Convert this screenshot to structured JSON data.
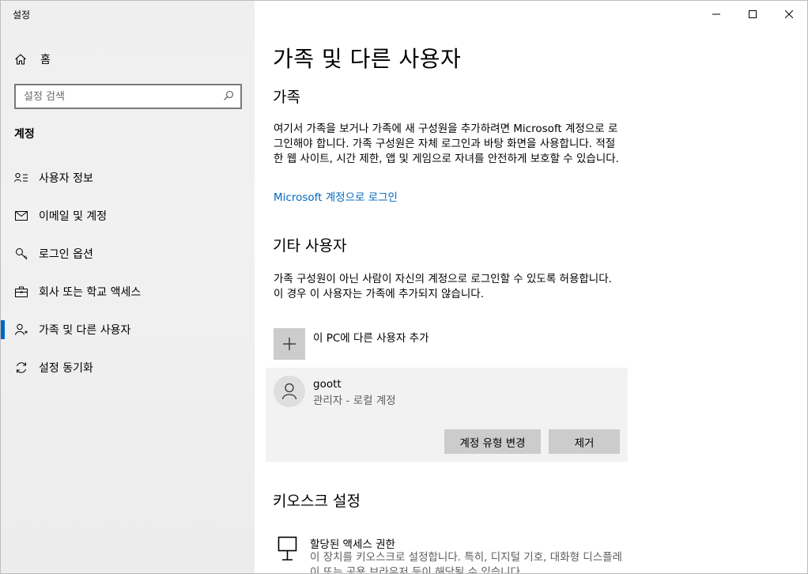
{
  "app": {
    "title": "설정"
  },
  "sidebar": {
    "home_label": "홈",
    "search_placeholder": "설정 검색",
    "section_label": "계정",
    "items": [
      {
        "label": "사용자 정보",
        "icon": "user-info-icon"
      },
      {
        "label": "이메일 및 계정",
        "icon": "mail-icon"
      },
      {
        "label": "로그인 옵션",
        "icon": "key-icon"
      },
      {
        "label": "회사 또는 학교 액세스",
        "icon": "briefcase-icon"
      },
      {
        "label": "가족 및 다른 사용자",
        "icon": "person-add-icon",
        "selected": true
      },
      {
        "label": "설정 동기화",
        "icon": "sync-icon"
      }
    ]
  },
  "main": {
    "title": "가족 및 다른 사용자",
    "family": {
      "heading": "가족",
      "description": "여기서 가족을 보거나 가족에 새 구성원을 추가하려면 Microsoft 계정으로 로그인해야 합니다. 가족 구성원은 자체 로그인과 바탕 화면을 사용합니다. 적절한 웹 사이트, 시간 제한, 앱 및 게임으로 자녀를 안전하게 보호할 수 있습니다.",
      "link": "Microsoft 계정으로 로그인"
    },
    "other_users": {
      "heading": "기타 사용자",
      "description": "가족 구성원이 아닌 사람이 자신의 계정으로 로그인할 수 있도록 허용합니다. 이 경우 이 사용자는 가족에 추가되지 않습니다.",
      "add_label": "이 PC에 다른 사용자 추가",
      "user": {
        "name": "goott",
        "role": "관리자 - 로컬 계정",
        "change_type_label": "계정 유형 변경",
        "remove_label": "제거"
      }
    },
    "kiosk": {
      "heading": "키오스크 설정",
      "item_title": "할당된 액세스 권한",
      "item_desc": "이 장치를 키오스크로 설정합니다. 특히, 디지털 기호, 대화형 디스플레이 또는 공용 브라우저 등이 해당될 수 있습니다."
    }
  },
  "accent_color": "#0067c0"
}
